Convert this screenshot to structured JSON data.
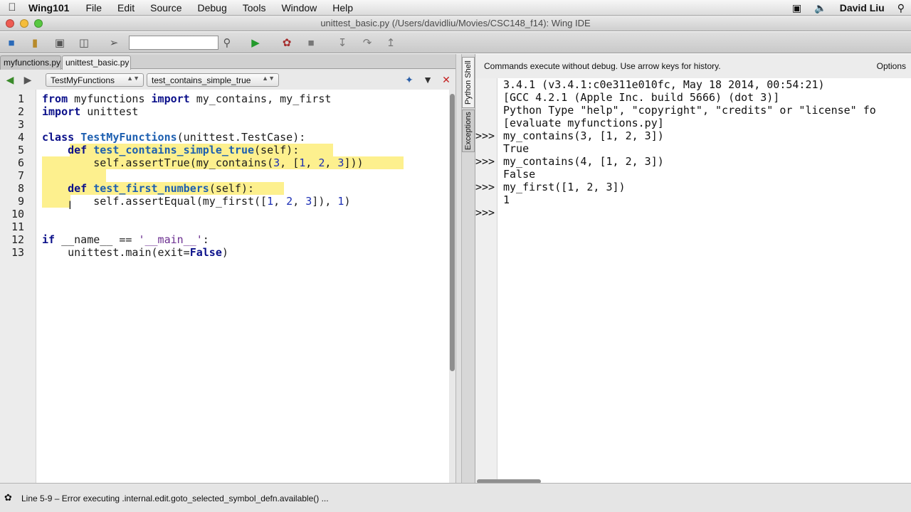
{
  "menubar": {
    "app_name": "Wing101",
    "menus": [
      "File",
      "Edit",
      "Source",
      "Debug",
      "Tools",
      "Window",
      "Help"
    ],
    "user": "David Liu"
  },
  "window": {
    "title": "unittest_basic.py (/Users/davidliu/Movies/CSC148_f14): Wing IDE"
  },
  "toolbar": {
    "search_value": ""
  },
  "editor": {
    "tabs": [
      "myfunctions.py",
      "unittest_basic.py"
    ],
    "active_tab": "unittest_basic.py",
    "class_dropdown": "TestMyFunctions",
    "method_dropdown": "test_contains_simple_true",
    "line_numbers": [
      "1",
      "2",
      "3",
      "4",
      "5",
      "6",
      "7",
      "8",
      "9",
      "10",
      "11",
      "12",
      "13"
    ],
    "highlighted_lines": "5-9"
  },
  "shell": {
    "side_tabs": [
      "Python Shell",
      "Exceptions"
    ],
    "header": "Commands execute without debug.  Use arrow keys for history.",
    "options_label": "Options",
    "prompt": ">>>",
    "output": [
      "3.4.1 (v3.4.1:c0e311e010fc, May 18 2014, 00:54:21)",
      "[GCC 4.2.1 (Apple Inc. build 5666) (dot 3)]",
      "Python Type \"help\", \"copyright\", \"credits\" or \"license\" fo",
      "[evaluate myfunctions.py]",
      "my_contains(3, [1, 2, 3])",
      "True",
      "my_contains(4, [1, 2, 3])",
      "False",
      "my_first([1, 2, 3])",
      "1",
      ""
    ]
  },
  "statusbar": {
    "message": "Line 5-9 – Error executing .internal.edit.goto_selected_symbol_defn.available() ..."
  },
  "colors": {
    "selection": "#fdf08e",
    "keyword": "#0b108a",
    "function_name": "#1d5fb0",
    "number": "#1c2fb5",
    "string": "#6a2d8f"
  }
}
